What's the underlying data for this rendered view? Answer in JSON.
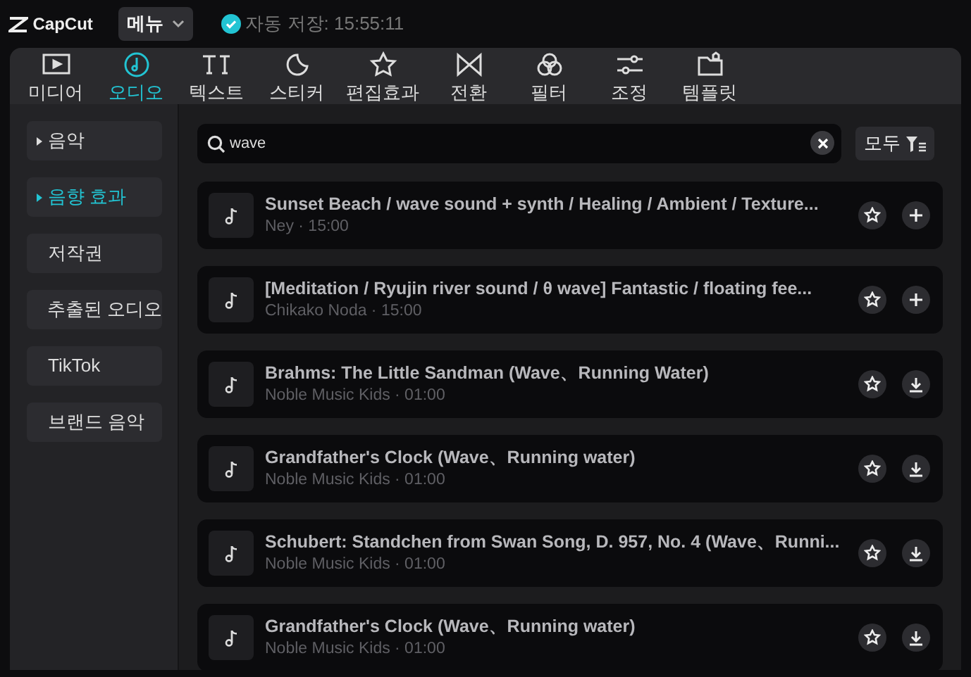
{
  "topbar": {
    "logo": "CapCut",
    "menu_button": "메뉴",
    "autosave": "자동 저장: 15:55:11"
  },
  "tabs": [
    {
      "label": "미디어",
      "selected": false
    },
    {
      "label": "오디오",
      "selected": true
    },
    {
      "label": "텍스트",
      "selected": false
    },
    {
      "label": "스티커",
      "selected": false
    },
    {
      "label": "편집효과",
      "selected": false
    },
    {
      "label": "전환",
      "selected": false
    },
    {
      "label": "필터",
      "selected": false
    },
    {
      "label": "조정",
      "selected": false
    },
    {
      "label": "템플릿",
      "selected": false
    }
  ],
  "sidebar": {
    "items": [
      {
        "label": "음악",
        "arrow": true,
        "selected": false
      },
      {
        "label": "음향 효과",
        "arrow": true,
        "selected": true
      },
      {
        "label": "저작권",
        "arrow": false,
        "selected": false
      },
      {
        "label": "추출된 오디오",
        "arrow": false,
        "selected": false
      },
      {
        "label": "TikTok",
        "arrow": false,
        "selected": false
      },
      {
        "label": "브랜드 음악",
        "arrow": false,
        "selected": false
      }
    ]
  },
  "search": {
    "value": "wave",
    "filter_label": "모두"
  },
  "tracks": [
    {
      "title": "Sunset Beach / wave sound + synth / Healing / Ambient / Texture...",
      "meta": "Ney · 15:00",
      "kind": "add"
    },
    {
      "title": "[Meditation / Ryujin river sound / θ wave] Fantastic / floating fee...",
      "meta": "Chikako Noda · 15:00",
      "kind": "add"
    },
    {
      "title": "Brahms: The Little Sandman (Wave、Running Water)",
      "meta": "Noble Music Kids · 01:00",
      "kind": "download"
    },
    {
      "title": "Grandfather's Clock (Wave、Running water)",
      "meta": "Noble Music Kids · 01:00",
      "kind": "download"
    },
    {
      "title": "Schubert: Standchen from Swan Song, D. 957, No. 4 (Wave、Runni...",
      "meta": "Noble Music Kids · 01:00",
      "kind": "download"
    },
    {
      "title": "Grandfather's Clock (Wave、Running water)",
      "meta": "Noble Music Kids · 01:00",
      "kind": "download"
    }
  ]
}
